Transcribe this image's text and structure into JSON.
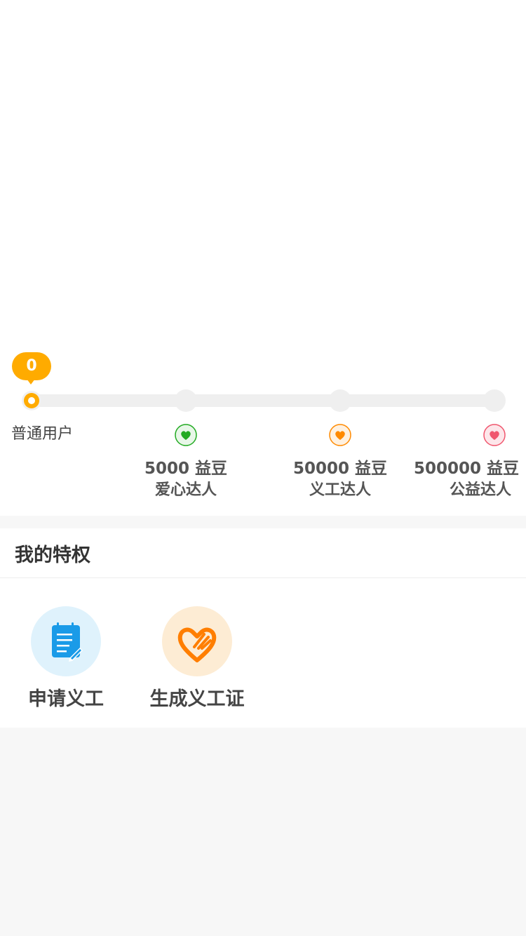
{
  "progress": {
    "current_points": "0",
    "current_level": "普通用户",
    "fraction": 0
  },
  "levels": [
    {
      "points": "5000 益豆",
      "name": "爱心达人",
      "icon": "heart-green-icon",
      "color": "#22aa22"
    },
    {
      "points": "50000 益豆",
      "name": "义工达人",
      "icon": "heart-orange-icon",
      "color": "#ff8a00"
    },
    {
      "points": "500000 益豆",
      "name": "公益达人",
      "icon": "heart-red-icon",
      "color": "#f0566e"
    }
  ],
  "privileges": {
    "title": "我的特权",
    "items": [
      {
        "label": "申请义工",
        "icon": "apply-notepad-icon",
        "bg": "#dff2fc",
        "color": "#1a9be8"
      },
      {
        "label": "生成义工证",
        "icon": "heart-hand-icon",
        "bg": "#fdecd4",
        "color": "#ff7e00"
      }
    ]
  },
  "colors": {
    "accent": "#ffab00",
    "track": "#efefef"
  }
}
